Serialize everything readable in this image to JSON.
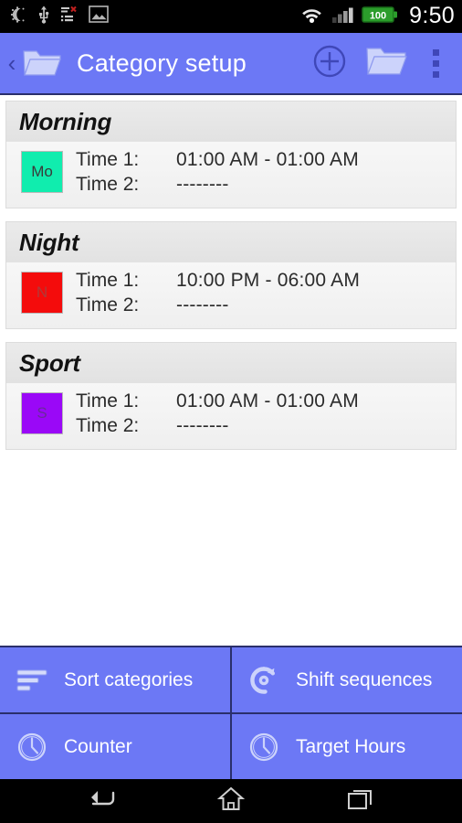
{
  "statusbar": {
    "icons": [
      "night-mode-icon",
      "usb-icon",
      "list-error-icon",
      "photo-icon"
    ],
    "wifi_icon": "wifi-icon",
    "signal_icon": "cellular-signal-icon",
    "battery_label": "100",
    "clock": "9:50"
  },
  "actionbar": {
    "back_glyph": "‹",
    "home_icon": "folder-icon",
    "title": "Category setup",
    "actions": [
      {
        "name": "add-category-button",
        "icon": "plus-circle-icon"
      },
      {
        "name": "open-folder-button",
        "icon": "folder-icon"
      },
      {
        "name": "overflow-menu-button",
        "icon": "overflow-dots-icon"
      }
    ]
  },
  "list": {
    "time1_label": "Time 1:",
    "time2_label": "Time 2:",
    "empty_time": "--------",
    "categories": [
      {
        "title": "Morning",
        "abbrev": "Mo",
        "color": "#10EDAE",
        "time1": "01:00 AM - 01:00 AM",
        "time2": "--------"
      },
      {
        "title": "Night",
        "abbrev": "N",
        "color": "#F40C0C",
        "time1": "10:00 PM - 06:00 AM",
        "time2": "--------"
      },
      {
        "title": "Sport",
        "abbrev": "S",
        "color": "#9A08F7",
        "time1": "01:00 AM - 01:00 AM",
        "time2": "--------"
      }
    ]
  },
  "bottom_buttons": [
    {
      "label": "Sort categories",
      "icon": "sort-lines-icon"
    },
    {
      "label": "Shift sequences",
      "icon": "rotate-circle-icon"
    },
    {
      "label": "Counter",
      "icon": "clock-icon"
    },
    {
      "label": "Target Hours",
      "icon": "clock-icon"
    }
  ],
  "navbar": {
    "back": "back-arrow-icon",
    "home": "home-icon",
    "recents": "recent-apps-icon"
  },
  "colors": {
    "accent": "#6C78F5",
    "accent_dark": "#2a2f6b",
    "card_header": "#E5E5E5"
  }
}
